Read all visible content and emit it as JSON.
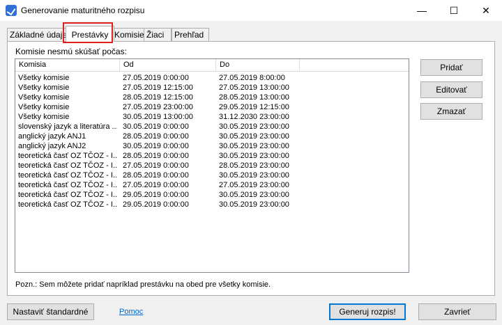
{
  "window": {
    "title": "Generovanie maturitného rozpisu",
    "minimize": "—",
    "maximize": "☐",
    "close": "✕"
  },
  "tabs": [
    {
      "label": "Základné údaje"
    },
    {
      "label": "Prestávky"
    },
    {
      "label": "Komisie"
    },
    {
      "label": "Žiaci"
    },
    {
      "label": "Prehľad"
    }
  ],
  "panel": {
    "group_label": "Komisie nesmú skúšať počas:",
    "note": "Pozn.: Sem môžete pridať napríklad prestávku na obed pre všetky komisie."
  },
  "list": {
    "columns": [
      "Komisia",
      "Od",
      "Do"
    ],
    "rows": [
      [
        "Všetky komisie",
        "27.05.2019 0:00:00",
        "27.05.2019 8:00:00"
      ],
      [
        "Všetky komisie",
        "27.05.2019 12:15:00",
        "27.05.2019 13:00:00"
      ],
      [
        "Všetky komisie",
        "28.05.2019 12:15:00",
        "28.05.2019 13:00:00"
      ],
      [
        "Všetky komisie",
        "27.05.2019 23:00:00",
        "29.05.2019 12:15:00"
      ],
      [
        "Všetky komisie",
        "30.05.2019 13:00:00",
        "31.12.2030 23:00:00"
      ],
      [
        "slovenský jazyk a literatúra ...",
        "30.05.2019 0:00:00",
        "30.05.2019 23:00:00"
      ],
      [
        "anglický jazyk ANJ1",
        "28.05.2019 0:00:00",
        "30.05.2019 23:00:00"
      ],
      [
        "anglický jazyk ANJ2",
        "30.05.2019 0:00:00",
        "30.05.2019 23:00:00"
      ],
      [
        "teoretická časť OZ TČOZ - I...",
        "28.05.2019 0:00:00",
        "30.05.2019 23:00:00"
      ],
      [
        "teoretická časť OZ TČOZ - I...",
        "27.05.2019 0:00:00",
        "28.05.2019 23:00:00"
      ],
      [
        "teoretická časť OZ TČOZ - I...",
        "28.05.2019 0:00:00",
        "30.05.2019 23:00:00"
      ],
      [
        "teoretická časť OZ TČOZ - I...",
        "27.05.2019 0:00:00",
        "27.05.2019 23:00:00"
      ],
      [
        "teoretická časť OZ TČOZ - I...",
        "29.05.2019 0:00:00",
        "30.05.2019 23:00:00"
      ],
      [
        "teoretická časť OZ TČOZ - I...",
        "29.05.2019 0:00:00",
        "30.05.2019 23:00:00"
      ]
    ]
  },
  "side_buttons": {
    "add": "Pridať",
    "edit": "Editovať",
    "delete": "Zmazať"
  },
  "footer": {
    "reset_label": "Nastaviť štandardné",
    "help_label": "Pomoc",
    "generate_label": "Generuj rozpis!",
    "close_label": "Zavrieť"
  },
  "colors": {
    "highlight": "#e02020",
    "default_button_border": "#0078d7",
    "link": "#0066cc"
  }
}
